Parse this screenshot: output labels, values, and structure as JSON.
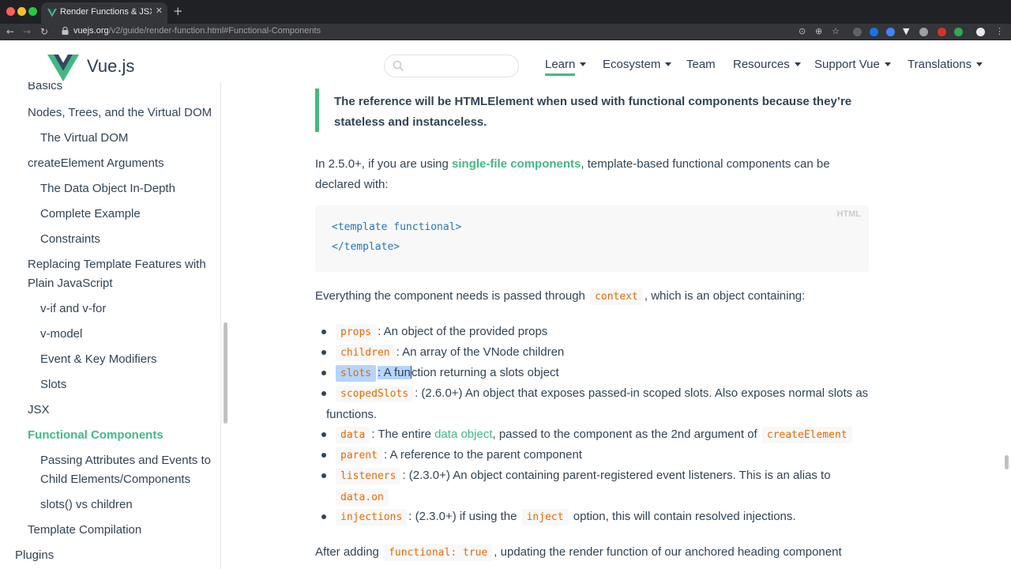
{
  "browser": {
    "tab_title": "Render Functions & JSX — Vue.js",
    "tab_close": "✕",
    "new_tab": "+",
    "url_domain": "vuejs.org",
    "url_path": "/v2/guide/render-function.html#Functional-Components",
    "nav_back": "←",
    "nav_forward": "→",
    "nav_reload": "↻"
  },
  "header": {
    "brand": "Vue.js",
    "search_placeholder": "",
    "nav": [
      {
        "label": "Learn",
        "dropdown": true,
        "active": true
      },
      {
        "label": "Ecosystem",
        "dropdown": true
      },
      {
        "label": "Team",
        "dropdown": false
      },
      {
        "label": "Resources",
        "dropdown": true
      },
      {
        "label": "Support Vue",
        "dropdown": true
      },
      {
        "label": "Translations",
        "dropdown": true
      }
    ]
  },
  "sidebar": {
    "items": [
      {
        "label": "Basics",
        "level": 2
      },
      {
        "label": "Nodes, Trees, and the Virtual DOM",
        "level": 2
      },
      {
        "label": "The Virtual DOM",
        "level": 3
      },
      {
        "label": "createElement Arguments",
        "level": 2
      },
      {
        "label": "The Data Object In-Depth",
        "level": 3
      },
      {
        "label": "Complete Example",
        "level": 3
      },
      {
        "label": "Constraints",
        "level": 3
      },
      {
        "label": "Replacing Template Features with",
        "level": 2
      },
      {
        "label": "Plain JavaScript",
        "level": 2
      },
      {
        "label": "v-if and v-for",
        "level": 3
      },
      {
        "label": "v-model",
        "level": 3
      },
      {
        "label": "Event & Key Modifiers",
        "level": 3
      },
      {
        "label": "Slots",
        "level": 3
      },
      {
        "label": "JSX",
        "level": 2
      },
      {
        "label": "Functional Components",
        "level": 2,
        "active": true
      },
      {
        "label": "Passing Attributes and Events to",
        "level": 3
      },
      {
        "label": "Child Elements/Components",
        "level": 3
      },
      {
        "label": "slots() vs children",
        "level": 3
      },
      {
        "label": "Template Compilation",
        "level": 2
      },
      {
        "label": "Plugins",
        "level": 1
      }
    ]
  },
  "content": {
    "tip": "The reference will be HTMLElement when used with functional components because they’re stateless and instanceless.",
    "p1_before": "In 2.5.0+, if you are using ",
    "p1_link": "single-file components",
    "p1_after": ", template-based functional components can be",
    "p1_line2": "declared with:",
    "code_lang": "HTML",
    "code_lines": [
      "<template functional>",
      "</template>"
    ],
    "p2_before": "Everything the component needs is passed through ",
    "p2_code": "context",
    "p2_after": ", which is an object containing:",
    "items": [
      {
        "code": "props",
        "text": ": An object of the provided props"
      },
      {
        "code": "children",
        "text": ": An array of the VNode children"
      },
      {
        "code": "slots",
        "text_hl": ": A fun",
        "text": "ction returning a slots object"
      },
      {
        "code": "scopedSlots",
        "text": ": (2.6.0+) An object that exposes passed-in scoped slots. Also exposes normal slots as",
        "text2": "functions."
      },
      {
        "code": "data",
        "text": ": The entire ",
        "link": "data object",
        "text_after": ", passed to the component as the 2nd argument of ",
        "code2": "createElement"
      },
      {
        "code": "parent",
        "text": ": A reference to the parent component"
      },
      {
        "code": "listeners",
        "text": ": (2.3.0+) An object containing parent-registered event listeners. This is an alias to",
        "code2": "data.on"
      },
      {
        "code": "injections",
        "text": ": (2.3.0+) if using the ",
        "code2": "inject",
        "text_after": " option, this will contain resolved injections."
      }
    ],
    "p3_before": "After adding ",
    "p3_code": "functional: true",
    "p3_after": ", updating the render function of our anchored heading component"
  },
  "colors": {
    "accent": "#42b983",
    "text": "#304455",
    "code": "#e96900",
    "code_block_text": "#2973b7",
    "selection": "#b4d5fe"
  }
}
